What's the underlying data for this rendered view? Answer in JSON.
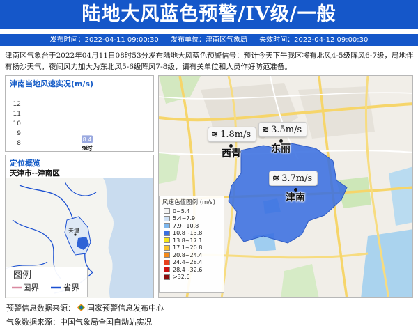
{
  "header": {
    "title": "陆地大风蓝色预警/IV级/一般",
    "issue_time": "发布时间：2022-04-11 09:00:30",
    "issuer": "发布单位：津南区气象局",
    "expire_time": "失效时间：2022-04-12 09:00:30"
  },
  "description": "津南区气象台于2022年04月11日08时53分发布陆地大风蓝色预警信号：预计今天下午我区将有北风4-5级阵风6-7级，局地伴有扬沙天气，夜间风力加大为东北风5-6级阵风7-8级，请有关单位和人员作好防范准备。",
  "wind_panel": {
    "title": "津南当地风速实况(m/s)"
  },
  "chart_data": {
    "type": "bar",
    "categories": [
      "9时"
    ],
    "values": [
      8.4
    ],
    "data_labels": [
      "8.4"
    ],
    "title": "津南当地风速实况(m/s)",
    "xlabel": "",
    "ylabel": "",
    "ylim": [
      8,
      12
    ],
    "y_ticks": [
      8,
      9,
      10,
      11,
      12
    ],
    "y_tick_labels": [
      "8",
      "9",
      "10",
      "11",
      "12"
    ],
    "grid": false,
    "bar_color": "#9aa9e0"
  },
  "position_panel": {
    "title": "定位概览",
    "subtitle": "天津市--津南区",
    "inset_city_label": "天津"
  },
  "map": {
    "wind_readings": [
      {
        "speed": "1.8m/s",
        "icon": "wind-icon"
      },
      {
        "speed": "3.5m/s",
        "icon": "wind-icon"
      },
      {
        "speed": "3.7m/s",
        "icon": "wind-icon"
      }
    ],
    "cities": [
      {
        "name": "西青"
      },
      {
        "name": "东丽"
      },
      {
        "name": "津南"
      }
    ],
    "region_color": "#3a6fe0",
    "legend": {
      "title": "风速色值图例 (m/s)",
      "items": [
        {
          "label": "0~5.4",
          "color": "#f5f5f5"
        },
        {
          "label": "5.4~7.9",
          "color": "#cfe2f7"
        },
        {
          "label": "7.9~10.8",
          "color": "#7db6ec"
        },
        {
          "label": "10.8~13.8",
          "color": "#3a6fe0"
        },
        {
          "label": "13.8~17.1",
          "color": "#f5e51a"
        },
        {
          "label": "17.1~20.8",
          "color": "#f7c22a"
        },
        {
          "label": "20.8~24.4",
          "color": "#f28a1a"
        },
        {
          "label": "24.4~28.4",
          "color": "#e8401c"
        },
        {
          "label": "28.4~32.6",
          "color": "#cc1414"
        },
        {
          "label": ">32.6",
          "color": "#8c0f0f"
        }
      ]
    }
  },
  "inset_legend": {
    "title": "图例",
    "national_border": "国界",
    "provincial_border": "省界",
    "national_color": "#d98aa0",
    "provincial_color": "#1a4fd1"
  },
  "footer": {
    "warning_source_label": "预警信息数据来源：",
    "warning_source": "国家预警信息发布中心",
    "weather_source": "气象数据来源：中国气象局全国自动站实况"
  }
}
